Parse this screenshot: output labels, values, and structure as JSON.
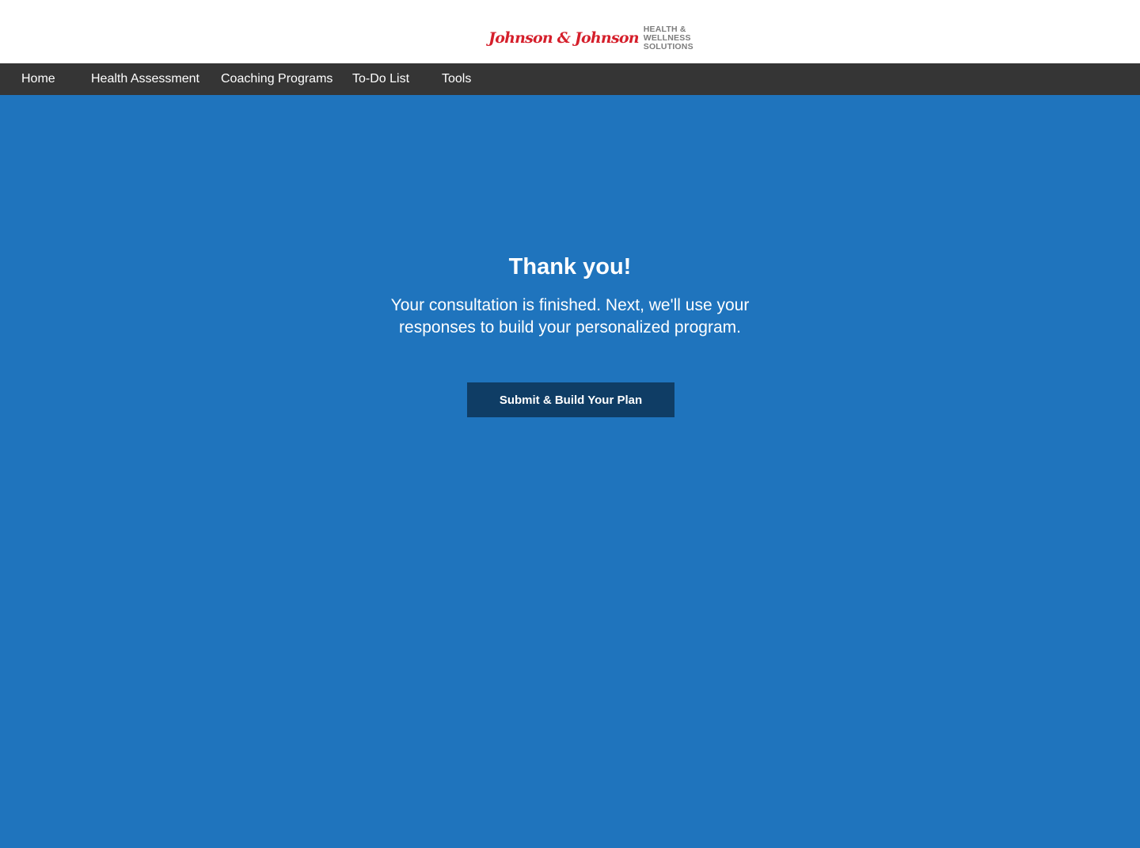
{
  "header": {
    "logo_script": "Johnson & Johnson",
    "logo_tagline": [
      "HEALTH &",
      "WELLNESS",
      "SOLUTIONS"
    ]
  },
  "nav": {
    "items": [
      {
        "label": "Home"
      },
      {
        "label": "Health Assessment"
      },
      {
        "label": "Coaching Programs"
      },
      {
        "label": "To-Do List"
      },
      {
        "label": "Tools"
      }
    ]
  },
  "main": {
    "title": "Thank you!",
    "message": "Your consultation is finished. Next, we'll use your responses to build your personalized program.",
    "submit_label": "Submit & Build Your Plan"
  },
  "colors": {
    "page_background": "#1f74bd",
    "nav_background": "#353535",
    "button_background": "#0f3d65",
    "logo_red": "#d51f2b",
    "logo_gray": "#7d7d7d"
  }
}
